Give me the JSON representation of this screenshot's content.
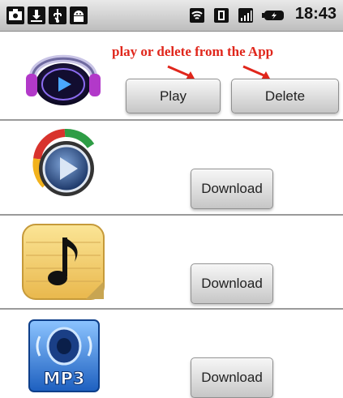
{
  "statusbar": {
    "time": "18:43",
    "icons": [
      "screenshot-icon",
      "download-icon",
      "usb-icon",
      "android-icon",
      "wifi-icon",
      "vibrate-icon",
      "signal-icon",
      "battery-icon"
    ]
  },
  "annotation": {
    "text": "play or delete from the App",
    "color": "#e0261b"
  },
  "rows": [
    {
      "icon": "headphones-media-icon",
      "buttons": [
        "Play",
        "Delete"
      ]
    },
    {
      "icon": "play-circle-icon",
      "buttons": [
        "Download"
      ]
    },
    {
      "icon": "music-note-icon",
      "buttons": [
        "Download"
      ]
    },
    {
      "icon": "mp3-speaker-icon",
      "icon_label": "MP3",
      "buttons": [
        "Download"
      ]
    }
  ]
}
